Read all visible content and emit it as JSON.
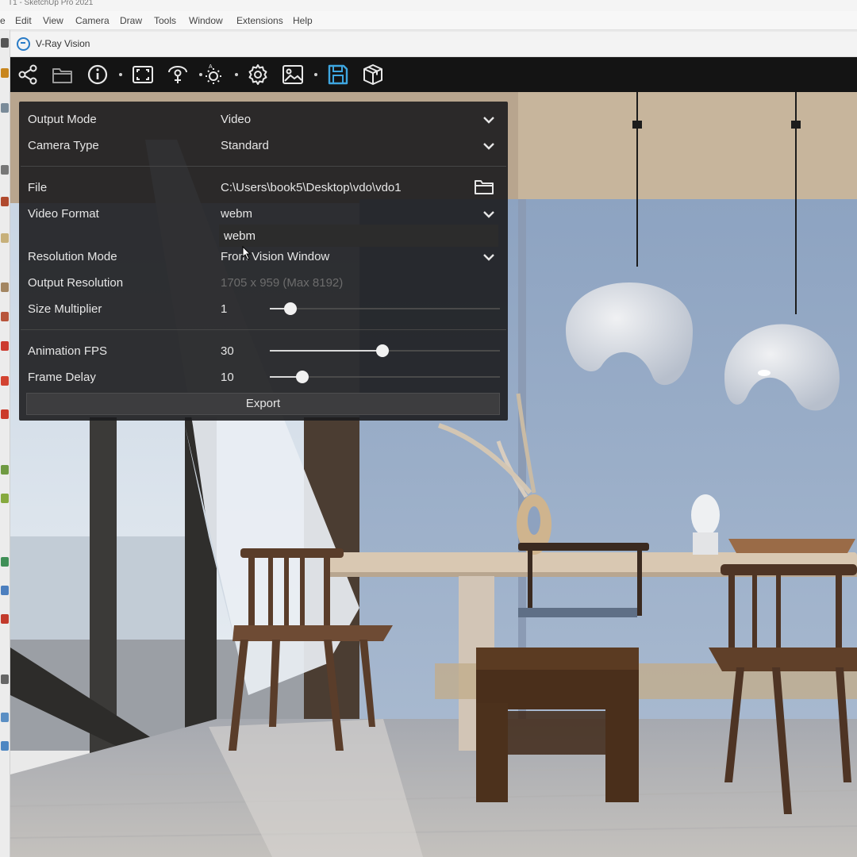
{
  "window": {
    "title": "T1 - SketchUp Pro 2021",
    "menus": [
      "e",
      "Edit",
      "View",
      "Camera",
      "Draw",
      "Tools",
      "Window",
      "Extensions",
      "Help"
    ]
  },
  "vision": {
    "title": "V-Ray Vision",
    "toolbar_icons": [
      "share-icon",
      "folder-open-icon",
      "info-icon",
      "fullscreen-icon",
      "camera-target-icon",
      "sun-settings-icon",
      "settings-gear-icon",
      "image-export-icon",
      "save-icon",
      "cube-icon"
    ]
  },
  "export_panel": {
    "output_mode": {
      "label": "Output Mode",
      "value": "Video"
    },
    "camera_type": {
      "label": "Camera Type",
      "value": "Standard"
    },
    "file": {
      "label": "File",
      "value": "C:\\Users\\book5\\Desktop\\vdo\\vdo1"
    },
    "video_format": {
      "label": "Video Format",
      "value": "webm",
      "dropdown_option": "webm"
    },
    "resolution_mode": {
      "label": "Resolution Mode",
      "value": "From Vision Window"
    },
    "output_resolution": {
      "label": "Output Resolution",
      "value": "1705 x 959 (Max 8192)"
    },
    "size_multiplier": {
      "label": "Size Multiplier",
      "value": "1",
      "slider_fraction": 0.09
    },
    "animation_fps": {
      "label": "Animation FPS",
      "value": "30",
      "slider_fraction": 0.49
    },
    "frame_delay": {
      "label": "Frame Delay",
      "value": "10",
      "slider_fraction": 0.14
    },
    "export_label": "Export"
  },
  "colors": {
    "toolbar_bg": "#141414",
    "panel_bg": "#1c1c1e",
    "accent_save": "#3ea6e0",
    "text": "#e6e6e6"
  }
}
